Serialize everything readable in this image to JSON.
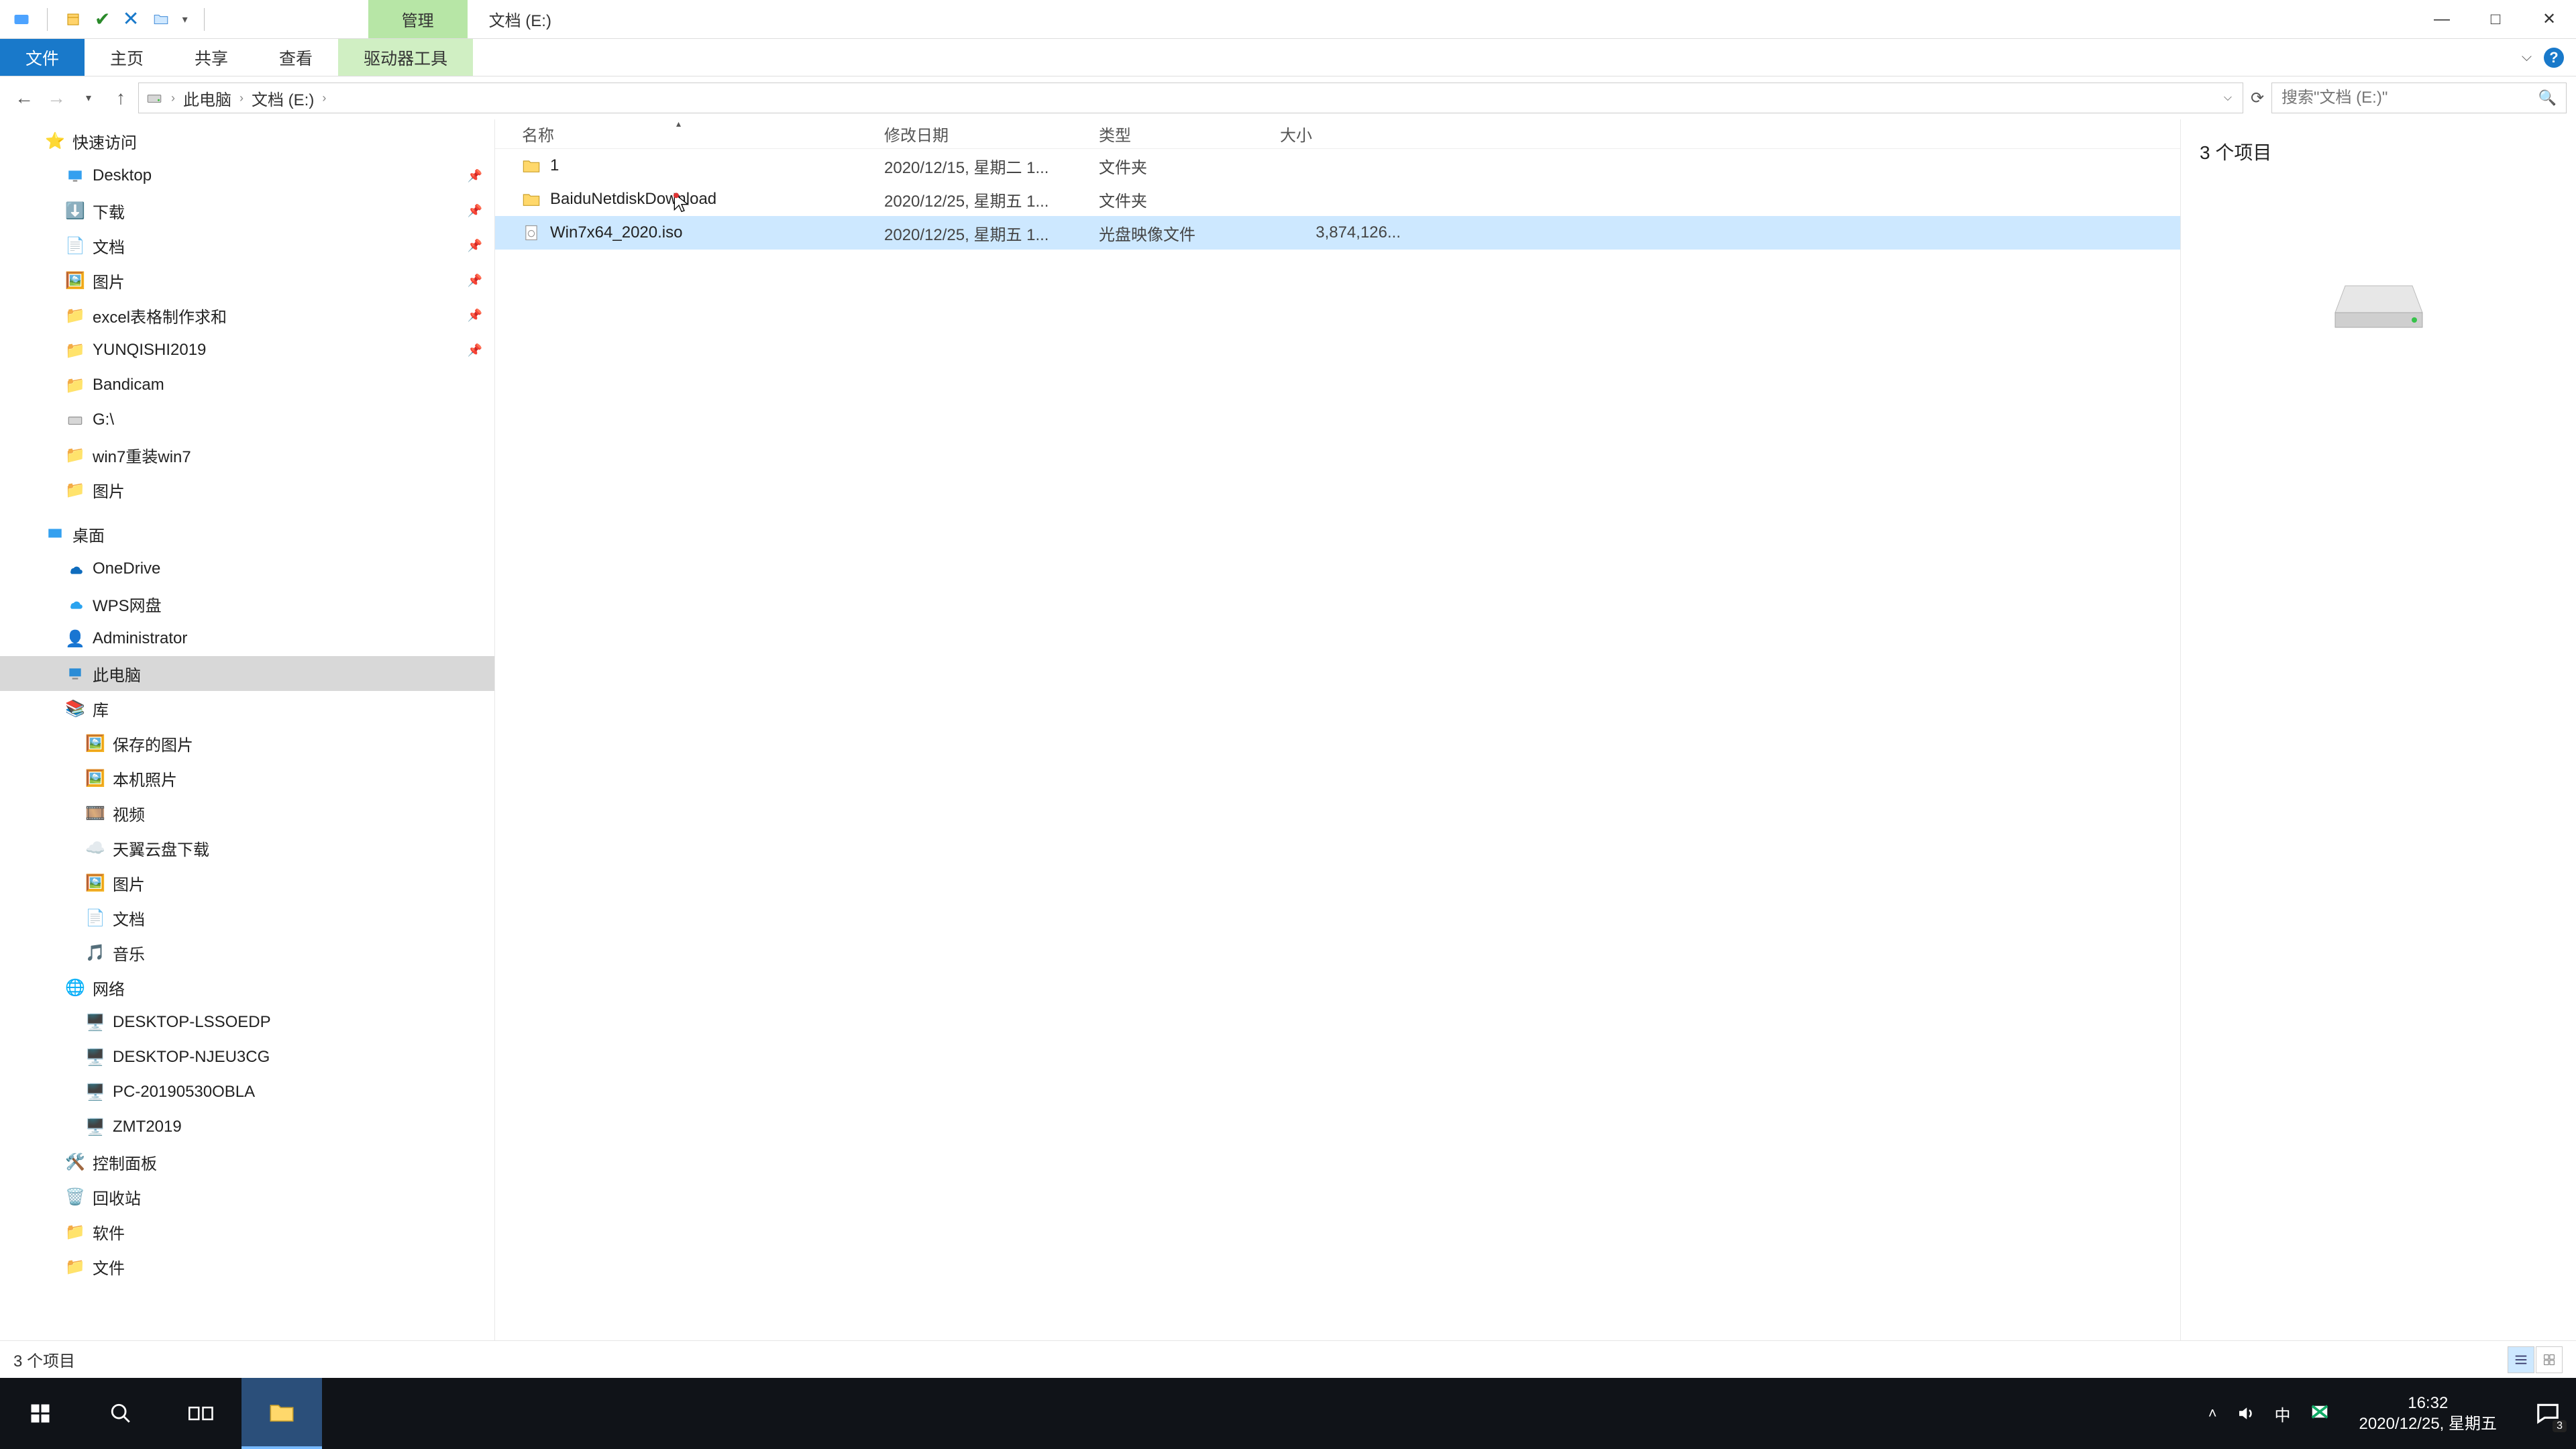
{
  "title": {
    "manage_tab": "管理",
    "window_title": "文档 (E:)"
  },
  "ribbon": {
    "file": "文件",
    "home": "主页",
    "share": "共享",
    "view": "查看",
    "drive_tools": "驱动器工具"
  },
  "addr": {
    "this_pc": "此电脑",
    "drive": "文档 (E:)"
  },
  "search": {
    "placeholder": "搜索\"文档 (E:)\""
  },
  "columns": {
    "name": "名称",
    "date": "修改日期",
    "type": "类型",
    "size": "大小"
  },
  "rows": [
    {
      "name": "1",
      "date": "2020/12/15, 星期二 1...",
      "type": "文件夹",
      "size": "",
      "icon": "folder"
    },
    {
      "name": "BaiduNetdiskDownload",
      "date": "2020/12/25, 星期五 1...",
      "type": "文件夹",
      "size": "",
      "icon": "folder"
    },
    {
      "name": "Win7x64_2020.iso",
      "date": "2020/12/25, 星期五 1...",
      "type": "光盘映像文件",
      "size": "3,874,126...",
      "icon": "iso",
      "selected": true
    }
  ],
  "details": {
    "item_count": "3 个项目"
  },
  "status": {
    "text": "3 个项目"
  },
  "tree": {
    "quick_access": "快速访问",
    "desktop": "Desktop",
    "downloads": "下载",
    "documents": "文档",
    "pictures": "图片",
    "excel_req": "excel表格制作求和",
    "yunqishi": "YUNQISHI2019",
    "bandicam": "Bandicam",
    "gdrive": "G:\\",
    "win7reinstall": "win7重装win7",
    "pictures2": "图片",
    "desktop_root": "桌面",
    "onedrive": "OneDrive",
    "wpspan": "WPS网盘",
    "administrator": "Administrator",
    "this_pc": "此电脑",
    "libraries": "库",
    "saved_pics": "保存的图片",
    "camera_roll": "本机照片",
    "videos": "视频",
    "tianyi": "天翼云盘下载",
    "lib_pictures": "图片",
    "lib_documents": "文档",
    "lib_music": "音乐",
    "network": "网络",
    "net1": "DESKTOP-LSSOEDP",
    "net2": "DESKTOP-NJEU3CG",
    "net3": "PC-20190530OBLA",
    "net4": "ZMT2019",
    "control_panel": "控制面板",
    "recycle": "回收站",
    "software": "软件",
    "files": "文件"
  },
  "taskbar": {
    "time": "16:32",
    "date": "2020/12/25, 星期五",
    "ime": "中",
    "notif_count": "3"
  }
}
